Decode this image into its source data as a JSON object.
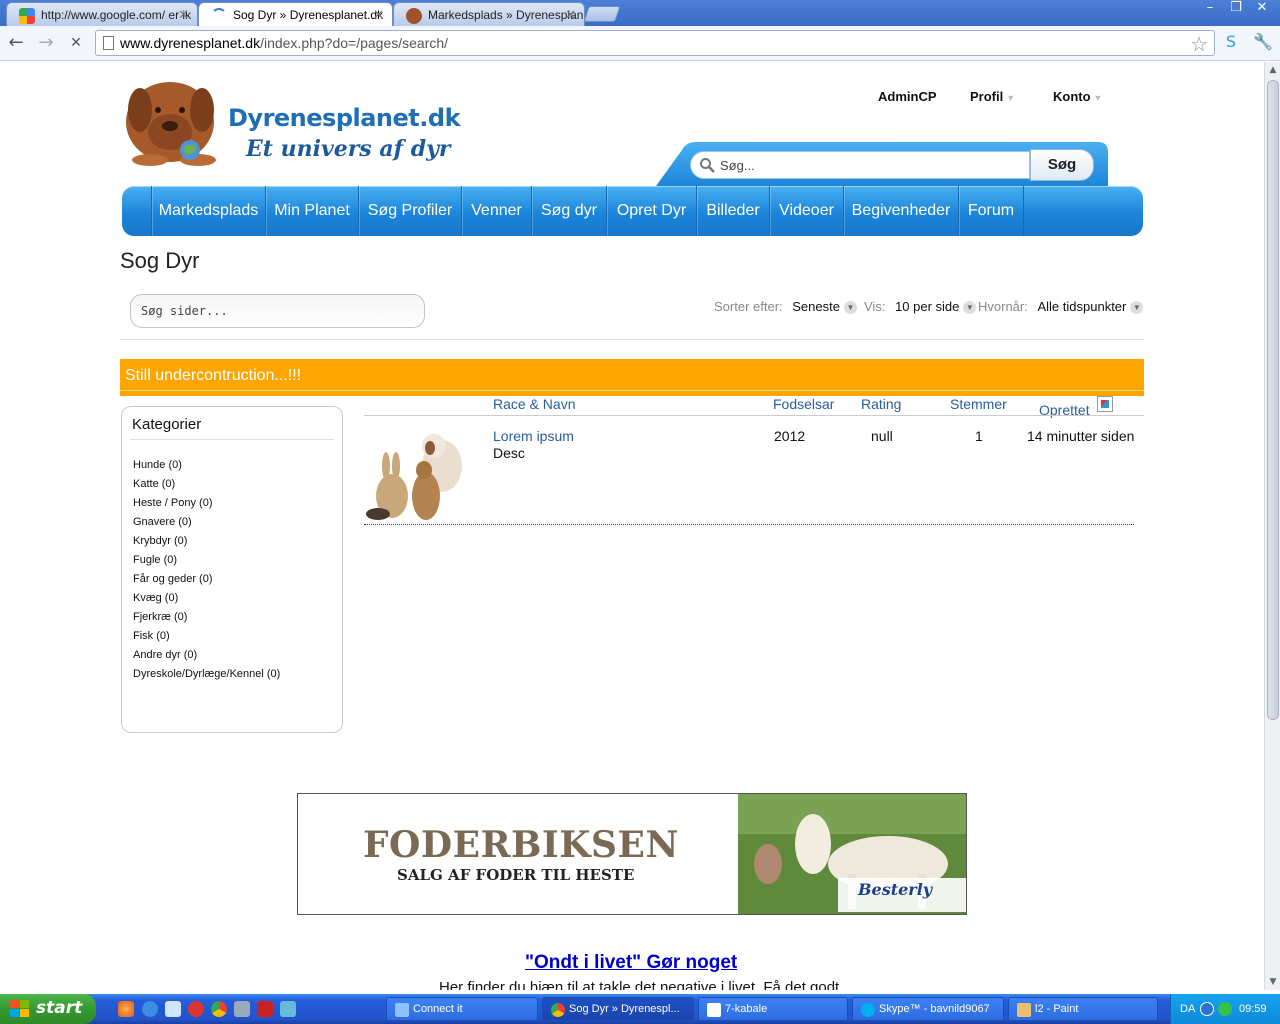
{
  "browser": {
    "tabs": [
      {
        "label": "http://www.google.com/ er ik",
        "active": false
      },
      {
        "label": "Sog Dyr » Dyrenesplanet.dk",
        "active": true
      },
      {
        "label": "Markedsplads » Dyrenesplane",
        "active": false
      }
    ],
    "url_host": "www.dyrenesplanet.dk",
    "url_path": "/index.php?do=/pages/search/"
  },
  "site": {
    "logo_title": "Dyrenesplanet.dk",
    "logo_subtitle": "Et univers af dyr",
    "user_links": {
      "admin": "AdminCP",
      "profile": "Profil",
      "account": "Konto"
    },
    "search": {
      "placeholder": "Søg...",
      "button": "Søg"
    },
    "nav": [
      "Markedsplads",
      "Min Planet",
      "Søg Profiler",
      "Venner",
      "Søg dyr",
      "Opret Dyr",
      "Billeder",
      "Videoer",
      "Begivenheder",
      "Forum"
    ]
  },
  "page": {
    "title": "Sog Dyr",
    "search_placeholder": "Søg sider...",
    "sort": {
      "sort_label": "Sorter efter:",
      "sort_value": "Seneste",
      "show_label": "Vis:",
      "show_value": "10 per side",
      "when_label": "Hvornår:",
      "when_value": "Alle tidspunkter"
    },
    "notice": "Still undercontruction...!!!",
    "categories_title": "Kategorier",
    "categories": [
      "Hunde (0)",
      "Katte (0)",
      "Heste / Pony (0)",
      "Gnavere (0)",
      "Krybdyr (0)",
      "Fugle (0)",
      "Får og geder (0)",
      "Kvæg (0)",
      "Fjerkræ (0)",
      "Fisk (0)",
      "Andre dyr (0)",
      "Dyreskole/Dyrlæge/Kennel (0)"
    ],
    "table_headers": {
      "race": "Race & Navn",
      "birth": "Fodselsar",
      "rating": "Rating",
      "votes": "Stemmer",
      "created": "Oprettet"
    },
    "rows": [
      {
        "name": "Lorem ipsum",
        "desc": "Desc",
        "birth": "2012",
        "rating": "null",
        "votes": "1",
        "created": "14 minutter siden"
      }
    ],
    "banner": {
      "title": "FODERBIKSEN",
      "subtitle": "SALG AF FODER TIL HESTE",
      "brand": "Besterly"
    },
    "promo_title": "\"Ondt i livet\" Gør noget",
    "promo_text": "Her finder du hjæn til at takle det negative i livet. Få det godt"
  },
  "taskbar": {
    "start": "start",
    "items": [
      {
        "label": "Connect it",
        "active": false
      },
      {
        "label": "Sog Dyr » Dyrenespl...",
        "active": true
      },
      {
        "label": "7-kabale",
        "active": false
      },
      {
        "label": "Skype™ - bavnild9067",
        "active": false
      },
      {
        "label": "l2 - Paint",
        "active": false
      }
    ],
    "language": "DA",
    "clock": "09:59"
  },
  "colors": {
    "nav_blue": "#1c85d9",
    "notice_orange": "#ffa500",
    "link_blue": "#2a5d9b",
    "logo_blue": "#1e6fb5"
  }
}
